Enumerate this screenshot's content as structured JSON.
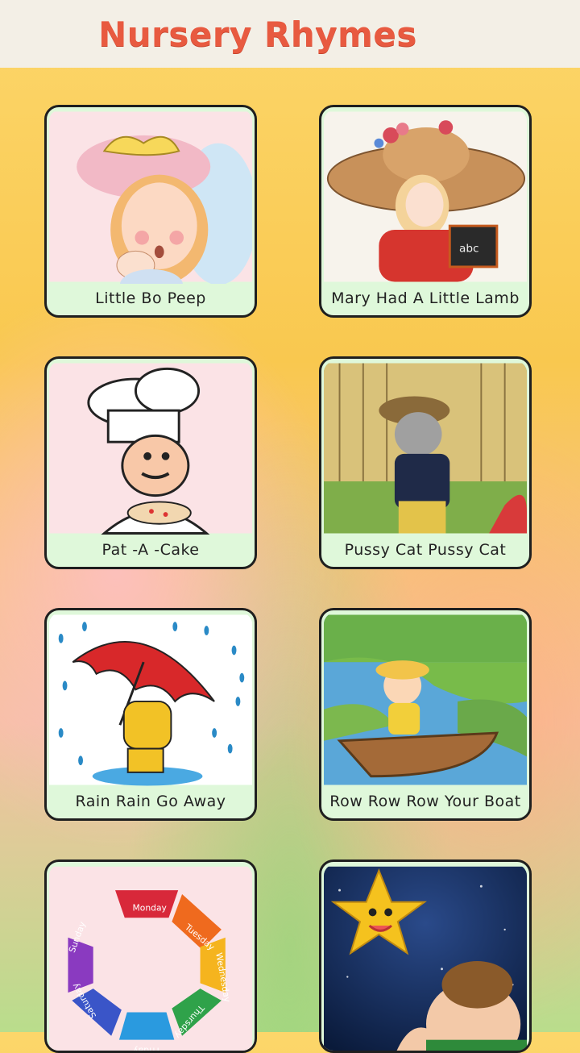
{
  "header": {
    "title": "Nursery Rhymes"
  },
  "rhymes": [
    {
      "label": "Little Bo Peep",
      "icon": "bo-peep-image"
    },
    {
      "label": "Mary Had A Little Lamb",
      "icon": "mary-image"
    },
    {
      "label": "Pat -A -Cake",
      "icon": "chef-image"
    },
    {
      "label": "Pussy Cat Pussy Cat",
      "icon": "cat-image"
    },
    {
      "label": "Rain Rain Go Away",
      "icon": "umbrella-image"
    },
    {
      "label": "Row Row Row Your Boat",
      "icon": "boat-image"
    },
    {
      "label": "",
      "icon": "days-of-week-image",
      "days": [
        "Monday",
        "Tuesday",
        "Wednesday",
        "Thursday",
        "Friday",
        "Saturday",
        "Sunday"
      ]
    },
    {
      "label": "",
      "icon": "star-image"
    }
  ]
}
